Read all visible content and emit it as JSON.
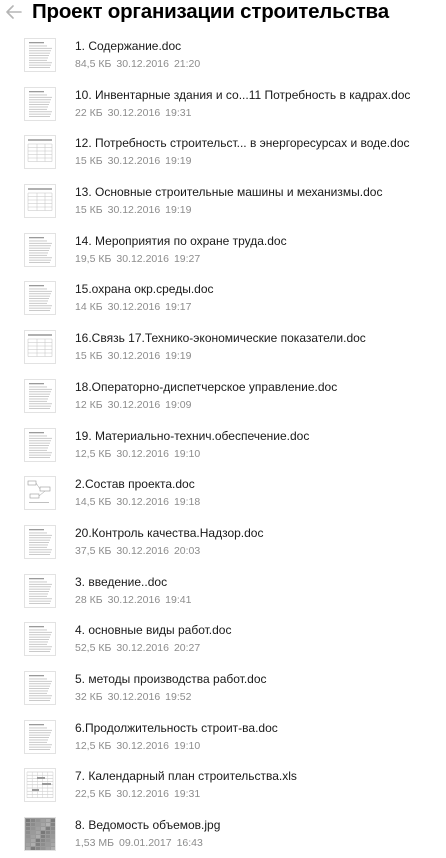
{
  "header": {
    "title": "Проект организации строительства",
    "back_icon": "arrow-left-icon"
  },
  "files": [
    {
      "name": "1. Содержание.doc",
      "size": "84,5 КБ",
      "date": "30.12.2016",
      "time": "21:20",
      "thumb": "doc"
    },
    {
      "name": "10. Инвентарные здания и со...11 Потребность в кадрах.doc",
      "size": "22 КБ",
      "date": "30.12.2016",
      "time": "19:31",
      "thumb": "doc"
    },
    {
      "name": "12. Потребность строительст... в энергоресурсах и воде.doc",
      "size": "15 КБ",
      "date": "30.12.2016",
      "time": "19:19",
      "thumb": "table"
    },
    {
      "name": "13. Основные строительные машины и механизмы.doc",
      "size": "15 КБ",
      "date": "30.12.2016",
      "time": "19:19",
      "thumb": "table"
    },
    {
      "name": "14. Мероприятия по охране труда.doc",
      "size": "19,5 КБ",
      "date": "30.12.2016",
      "time": "19:27",
      "thumb": "doc"
    },
    {
      "name": "15.охрана окр.среды.doc",
      "size": "14 КБ",
      "date": "30.12.2016",
      "time": "19:17",
      "thumb": "doc"
    },
    {
      "name": "16.Связь 17.Технико-экономические показатели.doc",
      "size": "15 КБ",
      "date": "30.12.2016",
      "time": "19:19",
      "thumb": "table"
    },
    {
      "name": "18.Операторно-диспетчерское управление.doc",
      "size": "12 КБ",
      "date": "30.12.2016",
      "time": "19:09",
      "thumb": "doc"
    },
    {
      "name": "19. Материально-технич.обеспечение.doc",
      "size": "12,5 КБ",
      "date": "30.12.2016",
      "time": "19:10",
      "thumb": "doc"
    },
    {
      "name": "2.Состав проекта.doc",
      "size": "14,5 КБ",
      "date": "30.12.2016",
      "time": "19:18",
      "thumb": "diagram"
    },
    {
      "name": "20.Контроль качества.Надзор.doc",
      "size": "37,5 КБ",
      "date": "30.12.2016",
      "time": "20:03",
      "thumb": "doc"
    },
    {
      "name": "3. введение..doc",
      "size": "28 КБ",
      "date": "30.12.2016",
      "time": "19:41",
      "thumb": "doc"
    },
    {
      "name": "4. основные виды работ.doc",
      "size": "52,5 КБ",
      "date": "30.12.2016",
      "time": "20:27",
      "thumb": "doc"
    },
    {
      "name": "5. методы производства работ.doc",
      "size": "32 КБ",
      "date": "30.12.2016",
      "time": "19:52",
      "thumb": "doc"
    },
    {
      "name": "6.Продолжительность строит-ва.doc",
      "size": "12,5 КБ",
      "date": "30.12.2016",
      "time": "19:10",
      "thumb": "doc"
    },
    {
      "name": "7. Календарный план строительства.xls",
      "size": "22,5 КБ",
      "date": "30.12.2016",
      "time": "19:31",
      "thumb": "sheet"
    },
    {
      "name": "8. Ведомость объемов.jpg",
      "size": "1,53 МБ",
      "date": "09.01.2017",
      "time": "16:43",
      "thumb": "image"
    }
  ]
}
